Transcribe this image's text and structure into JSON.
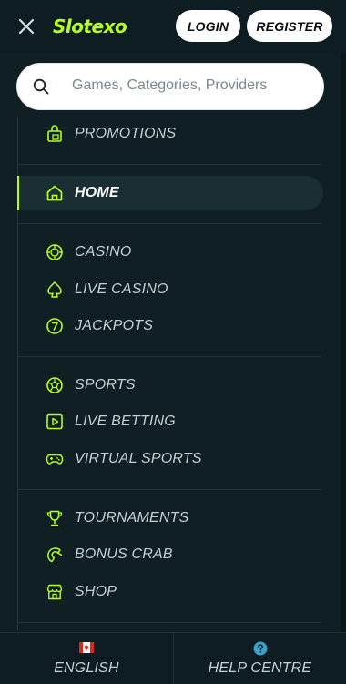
{
  "header": {
    "logo_text": "Slotexo",
    "login_label": "LOGIN",
    "register_label": "REGISTER",
    "icons": {
      "close": "close-icon",
      "logo": "slotexo-logo"
    }
  },
  "search": {
    "placeholder": "Games, Categories, Providers",
    "icon": "search-icon"
  },
  "menu": {
    "sections": [
      {
        "items": [
          {
            "label": "PROMOTIONS",
            "icon": "gift-bag-icon"
          }
        ]
      },
      {
        "items": [
          {
            "label": "HOME",
            "icon": "home-icon",
            "active": true
          }
        ]
      },
      {
        "items": [
          {
            "label": "CASINO",
            "icon": "casino-chip-icon"
          },
          {
            "label": "LIVE CASINO",
            "icon": "spade-icon"
          },
          {
            "label": "JACKPOTS",
            "icon": "seven-icon"
          }
        ]
      },
      {
        "items": [
          {
            "label": "SPORTS",
            "icon": "soccer-ball-icon"
          },
          {
            "label": "LIVE BETTING",
            "icon": "play-screen-icon"
          },
          {
            "label": "VIRTUAL SPORTS",
            "icon": "gamepad-icon"
          }
        ]
      },
      {
        "items": [
          {
            "label": "TOURNAMENTS",
            "icon": "trophy-icon"
          },
          {
            "label": "BONUS CRAB",
            "icon": "crab-claw-icon"
          },
          {
            "label": "SHOP",
            "icon": "shop-icon"
          }
        ]
      }
    ]
  },
  "footer": {
    "language_label": "ENGLISH",
    "language_icon": "canada-flag-icon",
    "help_label": "HELP CENTRE",
    "help_icon": "help-icon"
  },
  "colors": {
    "accent": "#b6ff1c",
    "background": "#0e1d22",
    "panel": "#0f1f24",
    "active_row": "#1b2e33",
    "text": "#c6d0d4"
  }
}
